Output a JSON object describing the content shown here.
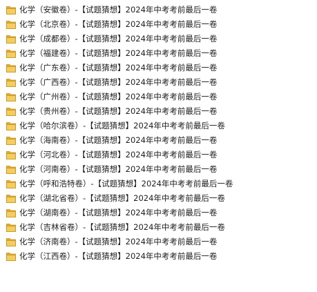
{
  "items": [
    {
      "label": "化学（安徽卷）-【试题猜想】2024年中考考前最后一卷",
      "icon": "folder-icon"
    },
    {
      "label": "化学（北京卷）-【试题猜想】2024年中考考前最后一卷",
      "icon": "folder-icon"
    },
    {
      "label": "化学（成都卷）-【试题猜想】2024年中考考前最后一卷",
      "icon": "folder-icon"
    },
    {
      "label": "化学（福建卷）-【试题猜想】2024年中考考前最后一卷",
      "icon": "folder-icon"
    },
    {
      "label": "化学（广东卷）-【试题猜想】2024年中考考前最后一卷",
      "icon": "folder-icon"
    },
    {
      "label": "化学（广西卷）-【试题猜想】2024年中考考前最后一卷",
      "icon": "folder-icon"
    },
    {
      "label": "化学（广州卷）-【试题猜想】2024年中考考前最后一卷",
      "icon": "folder-icon"
    },
    {
      "label": "化学（贵州卷）-【试题猜想】2024年中考考前最后一卷",
      "icon": "folder-icon"
    },
    {
      "label": "化学（哈尔滨卷）-【试题猜想】2024年中考考前最后一卷",
      "icon": "folder-icon"
    },
    {
      "label": "化学（海南卷）-【试题猜想】2024年中考考前最后一卷",
      "icon": "folder-icon"
    },
    {
      "label": "化学（河北卷）-【试题猜想】2024年中考考前最后一卷",
      "icon": "folder-icon"
    },
    {
      "label": "化学（河南卷）-【试题猜想】2024年中考考前最后一卷",
      "icon": "folder-icon"
    },
    {
      "label": "化学（呼和浩特卷）-【试题猜想】2024年中考考前最后一卷",
      "icon": "folder-icon"
    },
    {
      "label": "化学（湖北省卷）-【试题猜想】2024年中考考前最后一卷",
      "icon": "folder-icon"
    },
    {
      "label": "化学（湖南卷）-【试题猜想】2024年中考考前最后一卷",
      "icon": "folder-icon"
    },
    {
      "label": "化学（吉林省卷）-【试题猜想】2024年中考考前最后一卷",
      "icon": "folder-icon"
    },
    {
      "label": "化学（济南卷）-【试题猜想】2024年中考考前最后一卷",
      "icon": "folder-icon"
    },
    {
      "label": "化学（江西卷）-【试题猜想】2024年中考考前最后一卷",
      "icon": "folder-icon"
    }
  ],
  "colors": {
    "folder_front": "#f3cd5f",
    "folder_back": "#e0ab2e",
    "folder_edge": "#c98f17",
    "text": "#1e1e1e"
  }
}
